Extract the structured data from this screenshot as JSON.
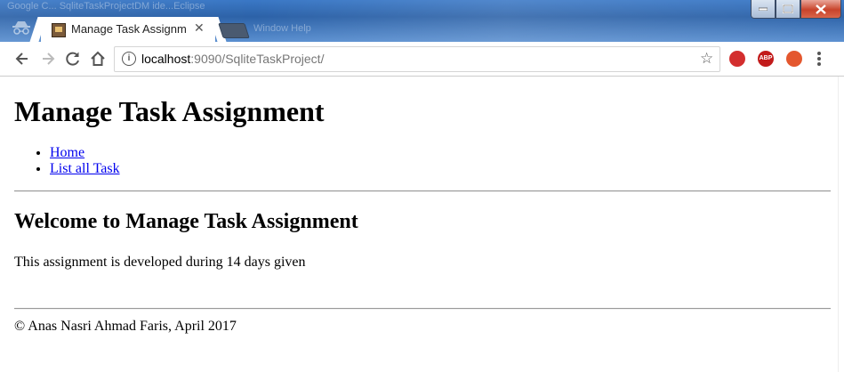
{
  "window": {
    "ghost_title": "Google C... SqliteTaskProjectDM ide...Eclipse",
    "ghost_menu": "Window  Help"
  },
  "tab": {
    "title": "Manage Task Assignmen",
    "close_glyph": "✕"
  },
  "toolbar": {
    "url_host": "localhost",
    "url_rest": ":9090/SqliteTaskProject/",
    "info_glyph": "i",
    "star_glyph": "☆",
    "ext_abp_label": "ABP"
  },
  "page": {
    "heading": "Manage Task Assignment",
    "nav": [
      {
        "label": "Home"
      },
      {
        "label": "List all Task"
      }
    ],
    "welcome": "Welcome to Manage Task Assignment",
    "description": "This assignment is developed during 14 days given",
    "footer": "© Anas Nasri Ahmad Faris, April 2017"
  },
  "colors": {
    "link": "#0000ee",
    "titlebar": "#2c62a8",
    "close_button": "#c8432b"
  }
}
